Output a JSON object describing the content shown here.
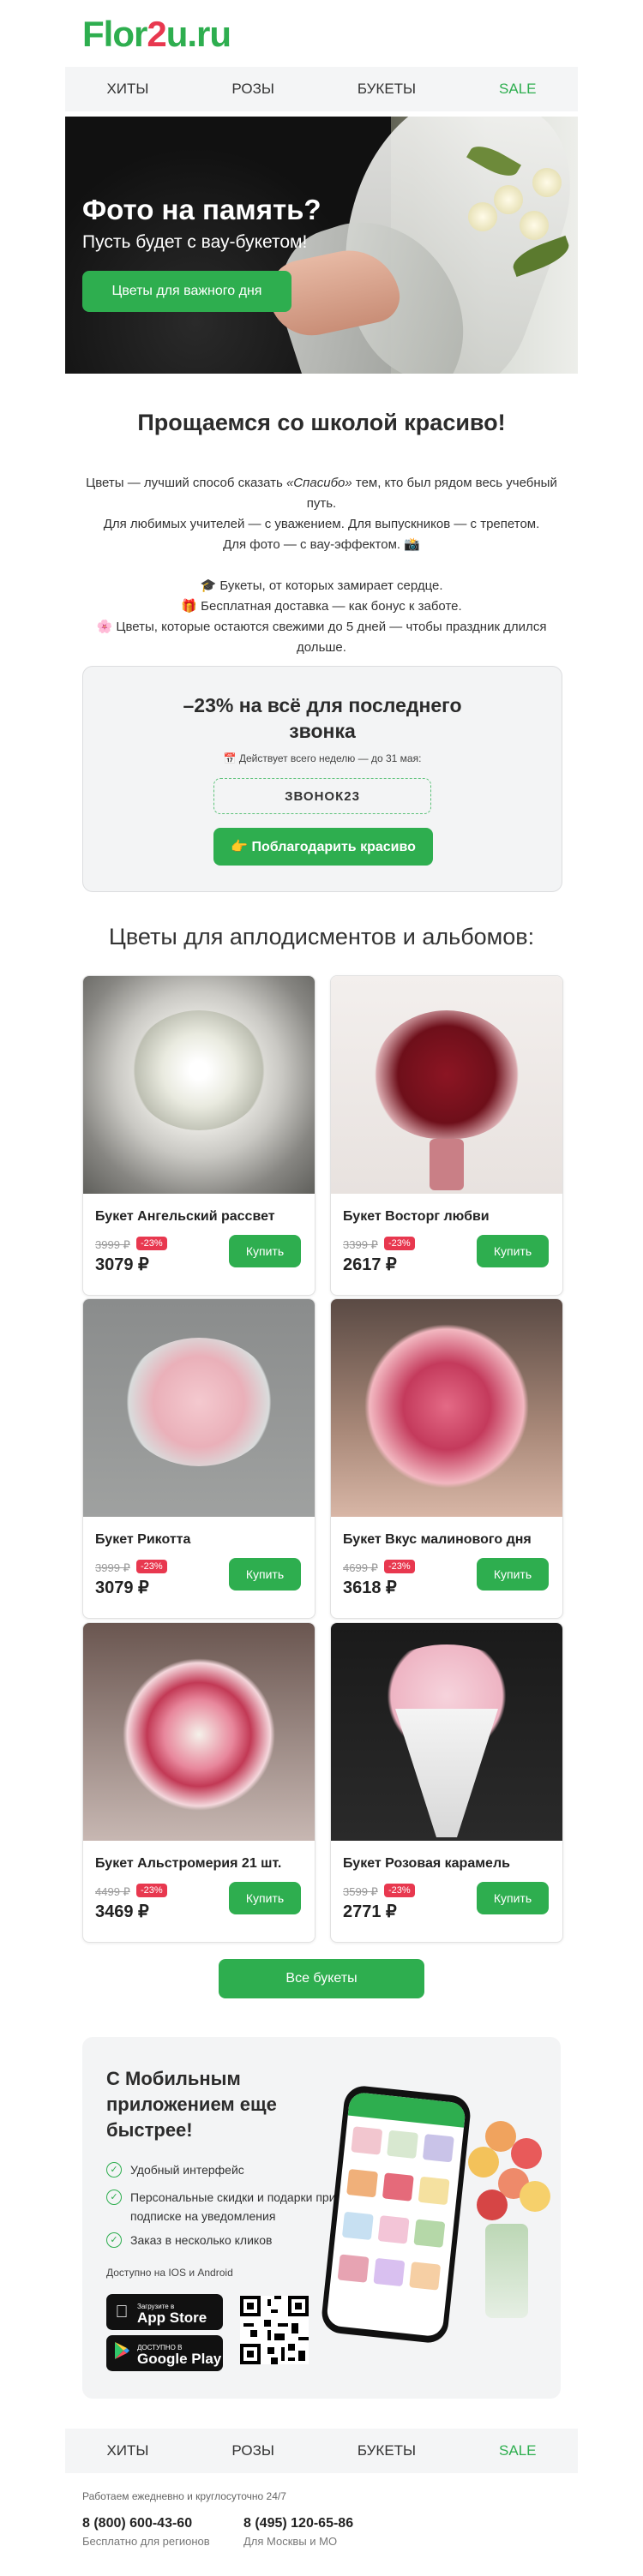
{
  "logo": {
    "part1": "Flor",
    "part2": "2",
    "part3": "u.ru"
  },
  "nav": {
    "items": [
      "ХИТЫ",
      "РОЗЫ",
      "БУКЕТЫ",
      "SALE"
    ]
  },
  "hero": {
    "title": "Фото на память?",
    "subtitle": "Пусть будет с вау-букетом!",
    "button": "Цветы для важного дня"
  },
  "intro": {
    "heading": "Прощаемся со школой красиво!",
    "line1a": "Цветы — лучший способ сказать ",
    "line1b": "«Спасибо»",
    "line1c": " тем, кто был рядом весь учебный путь.",
    "line2": "Для любимых учителей — с уважением. Для выпускников — с трепетом.",
    "line3": "Для фото — с вау-эффектом. 📸",
    "bullet1": "🎓 Букеты, от которых замирает сердце.",
    "bullet2": "🎁 Бесплатная доставка — как бонус к заботе.",
    "bullet3": "🌸 Цветы, которые остаются свежими до 5 дней — чтобы праздник длился дольше."
  },
  "promo": {
    "title": "–23% на всё для последнего звонка",
    "note": "📅 Действует всего неделю — до 31 мая:",
    "code": "ЗВОНОК23",
    "button": "👉 Поблагодарить красиво"
  },
  "products_title": "Цветы для аплодисментов и альбомов:",
  "products": [
    {
      "name": "Букет Ангельский рассвет",
      "old": "3999 ₽",
      "discount": "-23%",
      "price": "3079 ₽",
      "button": "Купить"
    },
    {
      "name": "Букет Восторг любви",
      "old": "3399 ₽",
      "discount": "-23%",
      "price": "2617 ₽",
      "button": "Купить"
    },
    {
      "name": "Букет Рикотта",
      "old": "3999 ₽",
      "discount": "-23%",
      "price": "3079 ₽",
      "button": "Купить"
    },
    {
      "name": "Букет Вкус малинового дня",
      "old": "4699 ₽",
      "discount": "-23%",
      "price": "3618 ₽",
      "button": "Купить"
    },
    {
      "name": "Букет Альстромерия 21 шт.",
      "old": "4499 ₽",
      "discount": "-23%",
      "price": "3469 ₽",
      "button": "Купить"
    },
    {
      "name": "Букет Розовая карамель",
      "old": "3599 ₽",
      "discount": "-23%",
      "price": "2771 ₽",
      "button": "Купить"
    }
  ],
  "all_button": "Все букеты",
  "app": {
    "title": "С Мобильным приложением еще быстрее!",
    "features": [
      "Удобный интерфейс",
      "Персональные скидки и подарки при подписке на уведомления",
      "Заказ в несколько кликов"
    ],
    "availability": "Доступно на IOS и Android",
    "appstore_small": "Загрузите в",
    "appstore_big": "App Store",
    "gplay_small": "ДОСТУПНО В",
    "gplay_big": "Google Play"
  },
  "footer": {
    "hours": "Работаем ежедневно и круглосуточно 24/7",
    "phone1": "8 (800) 600-43-60",
    "phone1_note": "Бесплатно для регионов",
    "phone2": "8 (495) 120-65-86",
    "phone2_note": "Для Москвы и МО"
  },
  "colors": {
    "accent": "#2eae4f",
    "discount": "#e8384f"
  }
}
